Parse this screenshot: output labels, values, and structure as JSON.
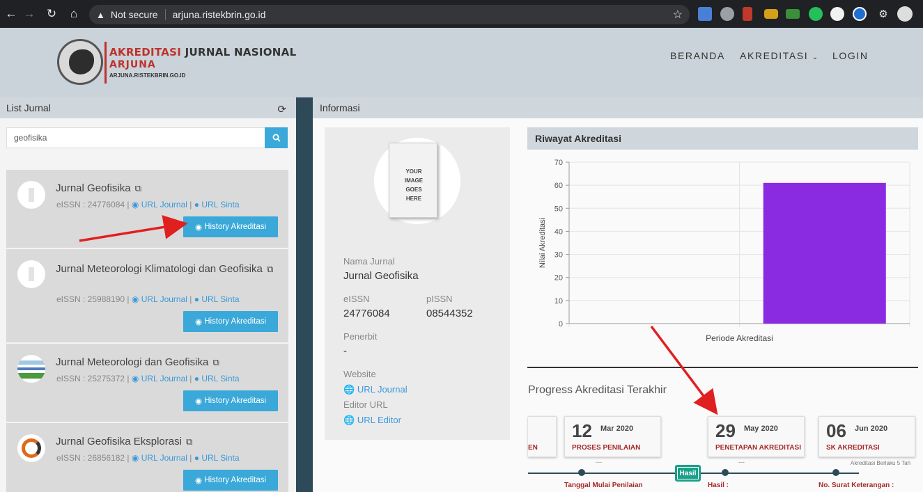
{
  "browser": {
    "security_label": "Not secure",
    "url": "arjuna.ristekbrin.go.id"
  },
  "site": {
    "logo": {
      "line1_red": "AKREDITASI",
      "line1_dark": "JURNAL NASIONAL",
      "line2": "ARJUNA",
      "line3": "ARJUNA.RISTEKBRIN.GO.ID"
    },
    "nav": {
      "beranda": "BERANDA",
      "akreditasi": "AKREDITASI",
      "login": "LOGIN"
    }
  },
  "list_panel": {
    "title": "List Jurnal",
    "search_value": "geofisika",
    "items": [
      {
        "title": "Jurnal Geofisika",
        "eissn": "eISSN : 24776084",
        "url_journal": "URL Journal",
        "url_sinta": "URL Sinta",
        "button": "History Akreditasi"
      },
      {
        "title": "Jurnal Meteorologi Klimatologi dan Geofisika",
        "eissn": "eISSN : 25988190",
        "url_journal": "URL Journal",
        "url_sinta": "URL Sinta",
        "button": "History Akreditasi"
      },
      {
        "title": "Jurnal Meteorologi dan Geofisika",
        "eissn": "eISSN : 25275372",
        "url_journal": "URL Journal",
        "url_sinta": "URL Sinta",
        "button": "History Akreditasi"
      },
      {
        "title": "Jurnal Geofisika Eksplorasi",
        "eissn": "eISSN : 26856182",
        "url_journal": "URL Journal",
        "url_sinta": "URL Sinta",
        "button": "History Akreditasi"
      }
    ]
  },
  "info_panel": {
    "title": "Informasi",
    "image_text": "YOUR IMAGE GOES HERE",
    "nama_jurnal_label": "Nama Jurnal",
    "nama_jurnal": "Jurnal Geofisika",
    "eissn_label": "eISSN",
    "eissn": "24776084",
    "pissn_label": "pISSN",
    "pissn": "08544352",
    "penerbit_label": "Penerbit",
    "penerbit": "-",
    "website_label": "Website",
    "website_link": "URL Journal",
    "editor_label": "Editor URL",
    "editor_link": "URL Editor"
  },
  "riwayat": {
    "title": "Riwayat Akreditasi",
    "progress_title": "Progress Akreditasi Terakhir"
  },
  "chart_data": {
    "type": "bar",
    "categories": [
      ""
    ],
    "values": [
      61
    ],
    "title": "",
    "xlabel": "Periode Akreditasi",
    "ylabel": "Nilai Akreditasi",
    "ylim": [
      0,
      70
    ],
    "yticks": [
      0,
      10,
      20,
      30,
      40,
      50,
      60,
      70
    ],
    "bar_color": "#8a2be2",
    "grid": true
  },
  "timeline": {
    "cards": [
      {
        "day": "",
        "month": "",
        "step": "EN"
      },
      {
        "day": "12",
        "month": "Mar 2020",
        "step": "PROSES PENILAIAN"
      },
      {
        "day": "29",
        "month": "May 2020",
        "step": "PENETAPAN AKREDITASI"
      },
      {
        "day": "06",
        "month": "Jun 2020",
        "step": "SK AKREDITASI"
      }
    ],
    "dash": "---",
    "hasil_badge": "Hasil",
    "labels": {
      "mulai": "Tanggal Mulai Penilaian",
      "hasil": "Hasil :",
      "no_surat": "No. Surat Keterangan :"
    },
    "berlaku": "Akreditasi Berlaku 5 Tah"
  }
}
